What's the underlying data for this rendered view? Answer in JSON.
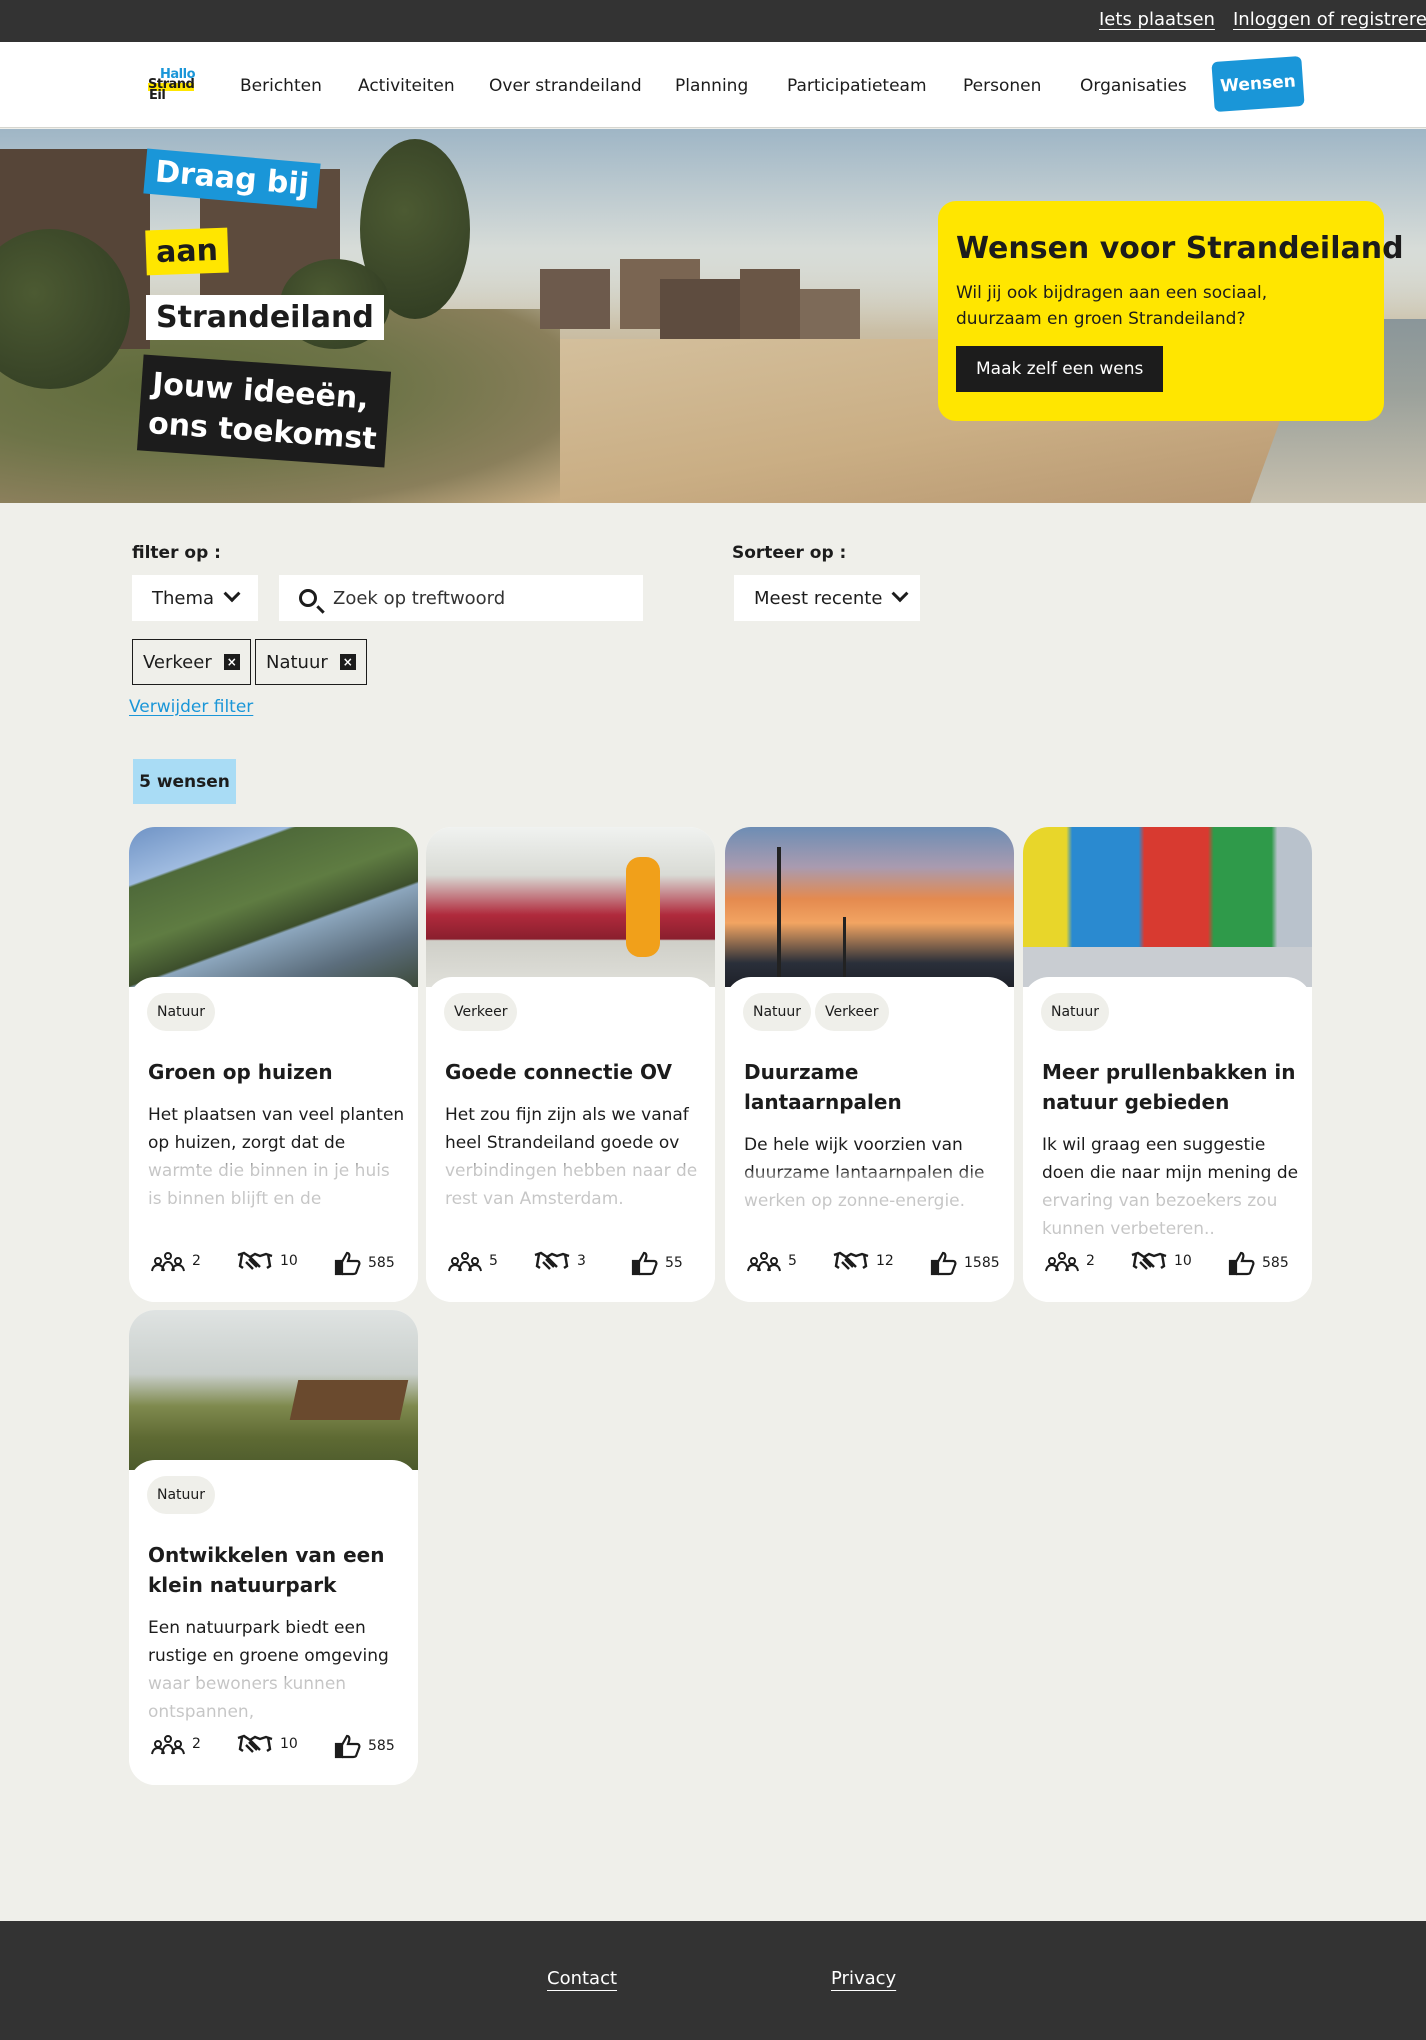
{
  "topbar": {
    "post_link": "Iets plaatsen",
    "login_link": "Inloggen of registreren"
  },
  "logo": {
    "line1": "Hallo",
    "line2": "Strand",
    "line3": "Eil"
  },
  "nav": {
    "items": [
      "Berichten",
      "Activiteiten",
      "Over strandeiland",
      "Planning",
      "Participatieteam",
      "Personen",
      "Organisaties"
    ],
    "active": "Wensen"
  },
  "hero": {
    "tags": [
      "Draag bij",
      "aan",
      "Strandeiland",
      "Jouw ideeën,",
      "ons toekomst"
    ],
    "card": {
      "title": "Wensen voor Strandeiland",
      "text": "Wil jij ook bijdragen aan een sociaal, duurzaam en groen Strandeiland?",
      "button": "Maak zelf een wens"
    },
    "colors": {
      "yellow": "#ffe600",
      "blue": "#1a96d8"
    }
  },
  "filters": {
    "filter_label": "filter op :",
    "theme_dropdown": "Thema",
    "search_placeholder": "Zoek op treftwoord",
    "sort_label": "Sorteer op :",
    "sort_value": "Meest recente",
    "active_chips": [
      "Verkeer",
      "Natuur"
    ],
    "reset_link": "Verwijder filter"
  },
  "result_count": "5 wensen",
  "cards": [
    {
      "categories": [
        "Natuur"
      ],
      "title": "Groen op huizen",
      "text": "Het plaatsen van veel planten op huizen, zorgt dat de warmte die binnen in je huis is binnen blijft en de",
      "participants": "2",
      "partners": "10",
      "likes": "585",
      "image": "green-facade"
    },
    {
      "categories": [
        "Verkeer"
      ],
      "title": "Goede connectie OV",
      "text": "Het zou fijn zijn als we vanaf heel Strandeiland goede ov verbindingen hebben naar de rest van Amsterdam.",
      "participants": "5",
      "partners": "3",
      "likes": "55",
      "image": "train-platform"
    },
    {
      "categories": [
        "Natuur",
        "Verkeer"
      ],
      "title": "Duurzame lantaarnpalen",
      "text": "De hele wijk voorzien van duurzame lantaarnpalen die werken op zonne-energie.",
      "participants": "5",
      "partners": "12",
      "likes": "1585",
      "image": "street-lights-sunset"
    },
    {
      "categories": [
        "Natuur"
      ],
      "title": "Meer prullenbakken in natuur gebieden",
      "text": "Ik wil graag een suggestie doen die naar mijn mening de ervaring van bezoekers zou kunnen verbeteren..",
      "participants": "2",
      "partners": "10",
      "likes": "585",
      "image": "waste-bins"
    },
    {
      "categories": [
        "Natuur"
      ],
      "title": "Ontwikkelen van een klein natuurpark",
      "text": "Een natuurpark biedt een rustige en groene omgeving waar bewoners kunnen ontspannen,",
      "participants": "2",
      "partners": "10",
      "likes": "585",
      "image": "park-bench"
    }
  ],
  "footer": {
    "contact": "Contact",
    "privacy": "Privacy"
  }
}
